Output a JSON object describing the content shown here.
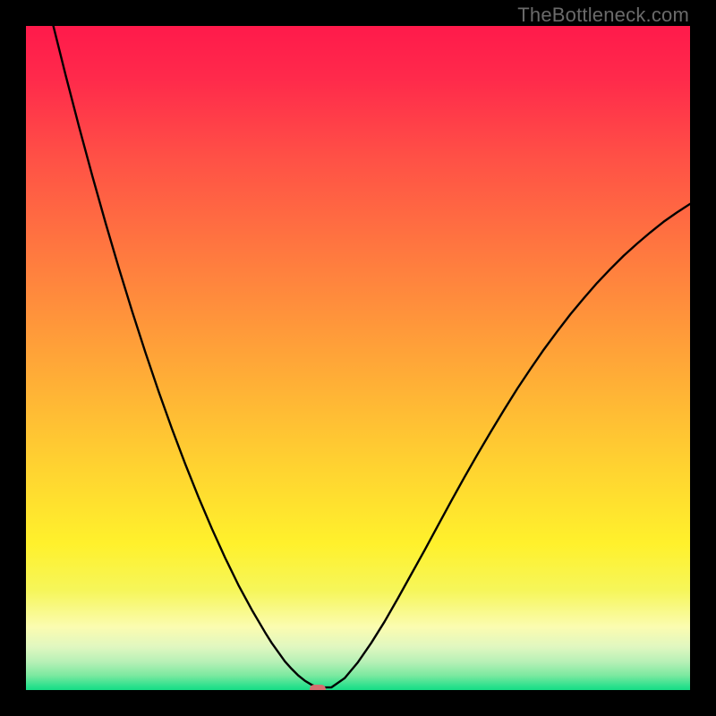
{
  "attribution": "TheBottleneck.com",
  "colors": {
    "background": "#000000",
    "gradient_stops": [
      {
        "offset": 0.0,
        "color": "#ff1a4b"
      },
      {
        "offset": 0.08,
        "color": "#ff2a4b"
      },
      {
        "offset": 0.2,
        "color": "#ff5146"
      },
      {
        "offset": 0.35,
        "color": "#ff7b3f"
      },
      {
        "offset": 0.5,
        "color": "#ffa538"
      },
      {
        "offset": 0.65,
        "color": "#ffcf31"
      },
      {
        "offset": 0.78,
        "color": "#fff12c"
      },
      {
        "offset": 0.85,
        "color": "#f6f65a"
      },
      {
        "offset": 0.905,
        "color": "#fbfcb0"
      },
      {
        "offset": 0.935,
        "color": "#e0f7c0"
      },
      {
        "offset": 0.958,
        "color": "#b6f0b6"
      },
      {
        "offset": 0.978,
        "color": "#7be9a0"
      },
      {
        "offset": 0.995,
        "color": "#28e08c"
      },
      {
        "offset": 1.0,
        "color": "#18dd86"
      }
    ],
    "curve": "#000000",
    "marker": "#d56f70",
    "attribution_text": "#6a6a6a"
  },
  "chart_data": {
    "type": "line",
    "title": "",
    "xlabel": "",
    "ylabel": "",
    "xlim": [
      0,
      100
    ],
    "ylim": [
      0,
      100
    ],
    "x": [
      0,
      2,
      4,
      6,
      8,
      10,
      12,
      14,
      16,
      18,
      20,
      22,
      24,
      26,
      28,
      30,
      32,
      34,
      36,
      37,
      38,
      39,
      40,
      41,
      42,
      43,
      44,
      46,
      48,
      50,
      52,
      54,
      56,
      58,
      60,
      62,
      64,
      66,
      68,
      70,
      72,
      74,
      76,
      78,
      80,
      82,
      84,
      86,
      88,
      90,
      92,
      94,
      96,
      98,
      100
    ],
    "values": [
      118,
      109,
      100.5,
      92.5,
      84.8,
      77.4,
      70.3,
      63.5,
      57.0,
      50.8,
      44.9,
      39.3,
      34.0,
      29.0,
      24.3,
      19.9,
      15.8,
      12.1,
      8.7,
      7.1,
      5.7,
      4.3,
      3.2,
      2.2,
      1.4,
      0.8,
      0.4,
      0.4,
      1.8,
      4.2,
      7.1,
      10.3,
      13.8,
      17.4,
      21.0,
      24.7,
      28.4,
      32.0,
      35.5,
      38.9,
      42.2,
      45.4,
      48.4,
      51.3,
      54.0,
      56.6,
      59.0,
      61.3,
      63.4,
      65.4,
      67.2,
      68.9,
      70.5,
      71.9,
      73.2
    ],
    "marker": {
      "x": 44.0,
      "y": 0.2
    },
    "notes": "V-shaped bottleneck curve over rainbow heatmap; y is bottleneck percentage, x is component balance axis (unlabeled)."
  }
}
